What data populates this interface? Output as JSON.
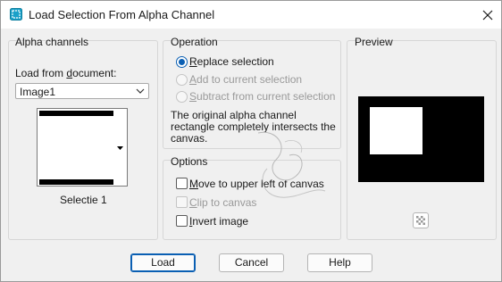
{
  "window": {
    "title": "Load Selection From Alpha Channel"
  },
  "alpha_channels": {
    "group_label": "Alpha channels",
    "load_from_label_pre": "Load from ",
    "load_from_label_u": "d",
    "load_from_label_post": "ocument:",
    "document_value": "Image1",
    "channel_name": "Selectie 1"
  },
  "operation": {
    "group_label": "Operation",
    "options": [
      {
        "u": "R",
        "rest": "eplace selection",
        "selected": true,
        "enabled": true
      },
      {
        "u": "A",
        "rest": "dd to current selection",
        "selected": false,
        "enabled": false
      },
      {
        "u": "S",
        "rest": "ubtract from current selection",
        "selected": false,
        "enabled": false
      }
    ],
    "message_line1": "The original alpha channel",
    "message_line2": "rectangle completely intersects the",
    "message_line3": "canvas."
  },
  "options": {
    "group_label": "Options",
    "items": [
      {
        "u": "M",
        "rest": "ove to upper left of canvas",
        "checked": false,
        "enabled": true
      },
      {
        "u": "C",
        "rest": "lip to canvas",
        "checked": false,
        "enabled": false
      },
      {
        "u": "I",
        "rest": "nvert image",
        "checked": false,
        "enabled": true
      }
    ]
  },
  "preview": {
    "group_label": "Preview"
  },
  "buttons": {
    "load": "Load",
    "cancel": "Cancel",
    "help": "Help"
  },
  "colors": {
    "accent": "#0a5fb3",
    "dialog_bg": "#f0f0f0",
    "app_icon": "#1ba1c9"
  },
  "icons": {
    "app": "selection-app-icon",
    "close": "close-icon",
    "dropdown": "chevron-down-icon",
    "checker": "checkerboard-icon"
  }
}
